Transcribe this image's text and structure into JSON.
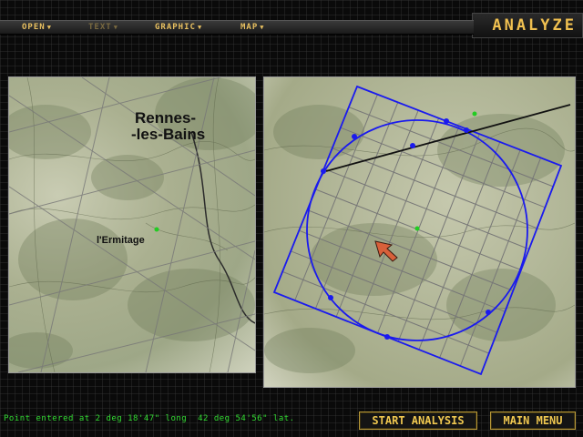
{
  "app": {
    "title": "ANALYZE"
  },
  "menubar": {
    "items": [
      {
        "label": "OPEN",
        "enabled": true
      },
      {
        "label": "TEXT",
        "enabled": false
      },
      {
        "label": "GRAPHIC",
        "enabled": true
      },
      {
        "label": "MAP",
        "enabled": true
      }
    ]
  },
  "left_map": {
    "labels": {
      "town": "Rennes-\n-les-Bains",
      "town_line1": "Rennes-",
      "town_line2": "-les-Bains",
      "site": "l'Ermitage"
    }
  },
  "right_map": {
    "overlay_color": "#1a1aee",
    "marker_color": "#22cc22",
    "cursor_color": "#d8603a"
  },
  "status": {
    "text": "Point entered at 2 deg 18'47\" long  42 deg 54'56\" lat."
  },
  "buttons": {
    "start_analysis": "START ANALYSIS",
    "main_menu": "MAIN MENU"
  }
}
